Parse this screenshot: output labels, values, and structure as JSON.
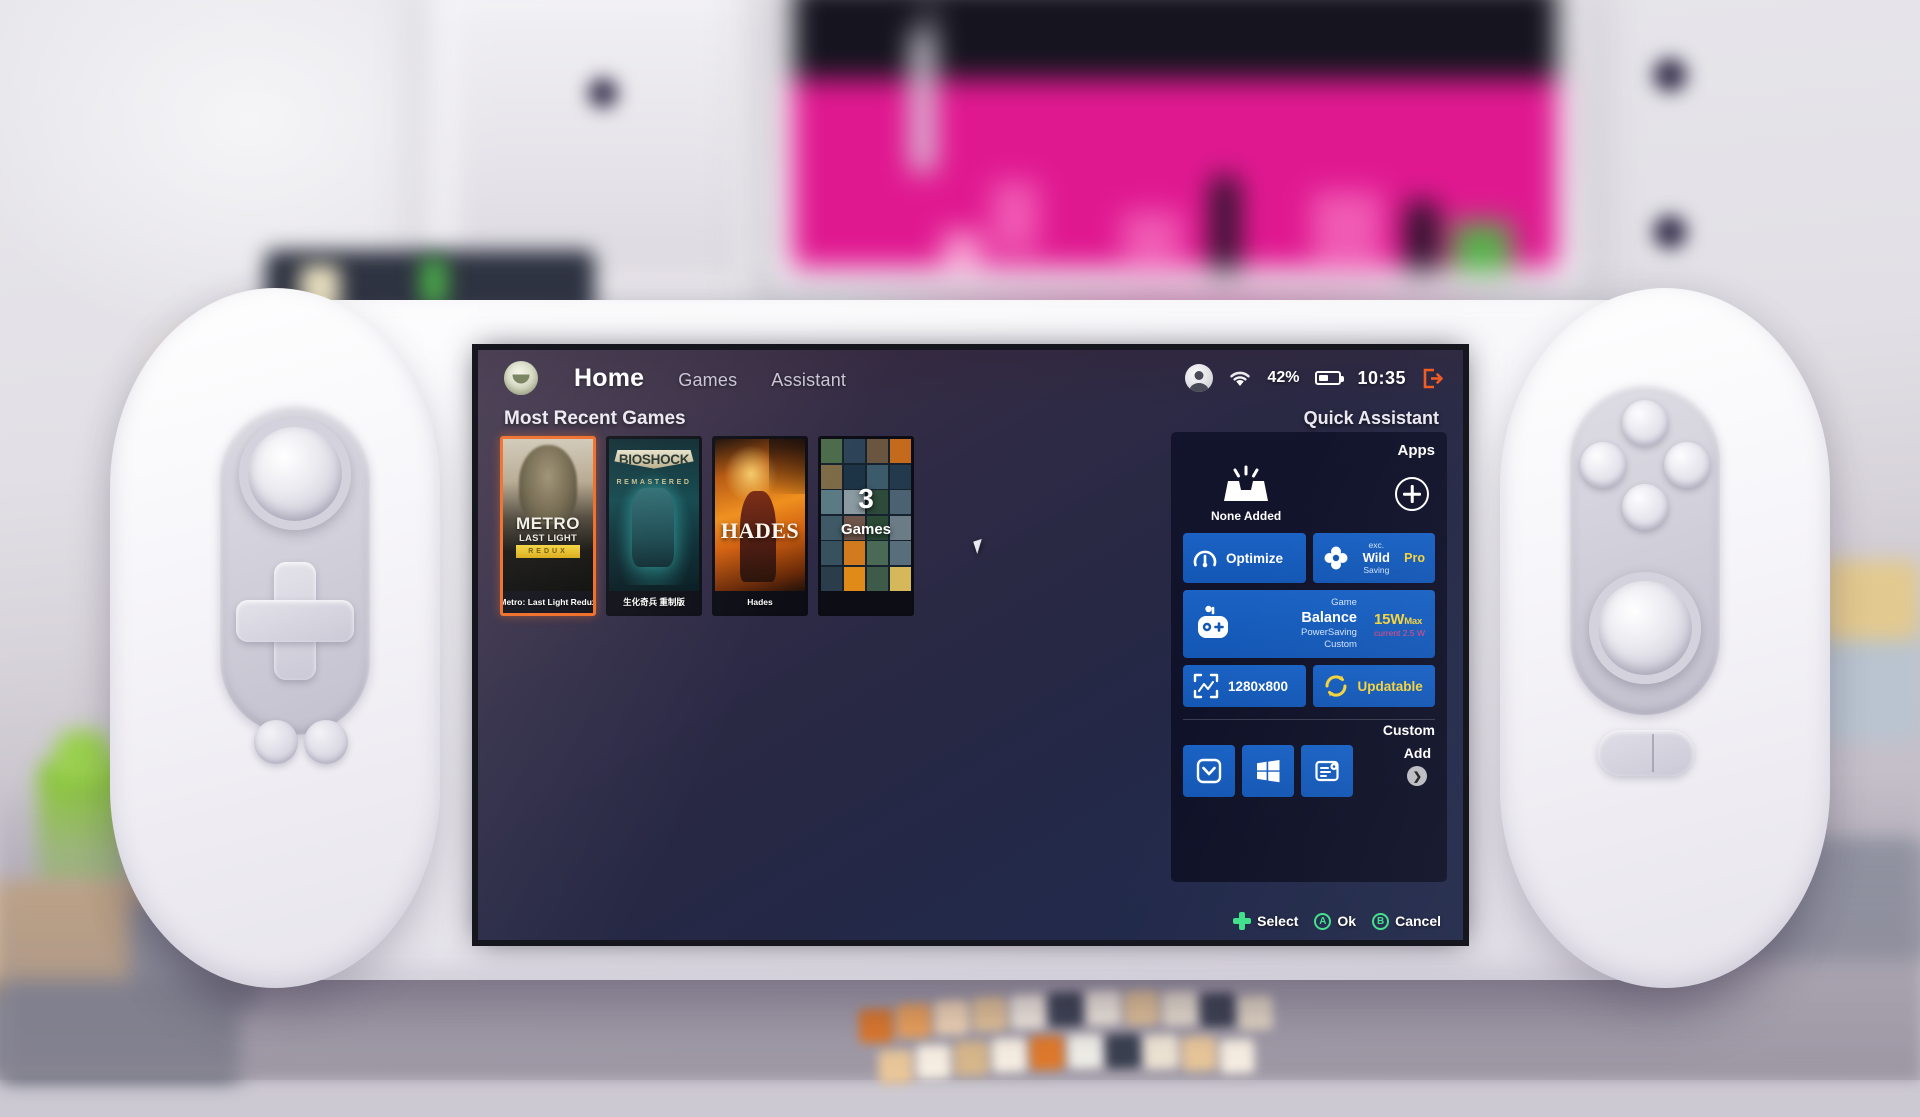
{
  "nav": {
    "avatar_icon": "leaf-avatar-icon",
    "links": [
      {
        "label": "Home",
        "active": true
      },
      {
        "label": "Games",
        "active": false
      },
      {
        "label": "Assistant",
        "active": false
      }
    ]
  },
  "status_bar": {
    "user_icon": "user-avatar-icon",
    "wifi_icon": "wifi-icon",
    "battery_percent": "42%",
    "battery_icon": "battery-icon",
    "time": "10:35",
    "exit_icon": "exit-logout-icon",
    "exit_color": "#ef5a22"
  },
  "games_section": {
    "title": "Most Recent Games",
    "cards": [
      {
        "title_line1": "METRO",
        "title_line2": "LAST LIGHT",
        "title_line3": "REDUX",
        "caption": "Metro: Last Light Redux",
        "selected": true
      },
      {
        "title_line1": "BIOSHOCK",
        "title_line2": "REMASTERED",
        "caption": "生化奇兵 重制版",
        "selected": false
      },
      {
        "title_line1": "HADES",
        "caption": "Hades",
        "selected": false
      },
      {
        "count": "3",
        "count_label": "Games",
        "caption": "",
        "selected": false
      }
    ]
  },
  "quick_assistant": {
    "title": "Quick Assistant",
    "apps": {
      "heading": "Apps",
      "empty_icon": "empty-tray-icon",
      "empty_label": "None Added",
      "add_icon": "plus-circle-icon"
    },
    "tiles": {
      "optimize": {
        "icon": "gauge-icon",
        "label": "Optimize"
      },
      "fan": {
        "icon": "fan-icon",
        "line1": "exc.",
        "line2": "Wild",
        "line3": "Saving",
        "badge": "Pro",
        "badge_color": "#f5d33c"
      },
      "power": {
        "icon": "tdp-robot-icon",
        "options": [
          "Game",
          "Balance",
          "PowerSaving",
          "Custom"
        ],
        "selected": "Balance",
        "watt_value": "15W",
        "watt_suffix": "Max",
        "watt_current": "current 2.5 W",
        "watt_color": "#f5d33c",
        "current_color": "#e8497f"
      },
      "resolution": {
        "icon": "resolution-frame-icon",
        "label": "1280x800"
      },
      "update": {
        "icon": "refresh-icon",
        "label": "Updatable",
        "color": "#f5d33c"
      }
    },
    "custom": {
      "heading": "Custom",
      "buttons": [
        {
          "icon": "chevron-down-box-icon"
        },
        {
          "icon": "windows-logo-icon"
        },
        {
          "icon": "document-settings-icon"
        }
      ],
      "add_label": "Add",
      "add_chevron_icon": "chevron-right-circle-icon"
    }
  },
  "button_hints": [
    {
      "icon": "dpad-icon",
      "label": "Select"
    },
    {
      "icon": "a-button-icon",
      "glyph": "A",
      "label": "Ok"
    },
    {
      "icon": "b-button-icon",
      "glyph": "B",
      "label": "Cancel"
    }
  ],
  "device": {
    "left_controls": [
      "analog-stick",
      "dpad",
      "small-buttons"
    ],
    "right_controls": [
      "abxy-buttons",
      "analog-stick",
      "pill-button"
    ]
  }
}
